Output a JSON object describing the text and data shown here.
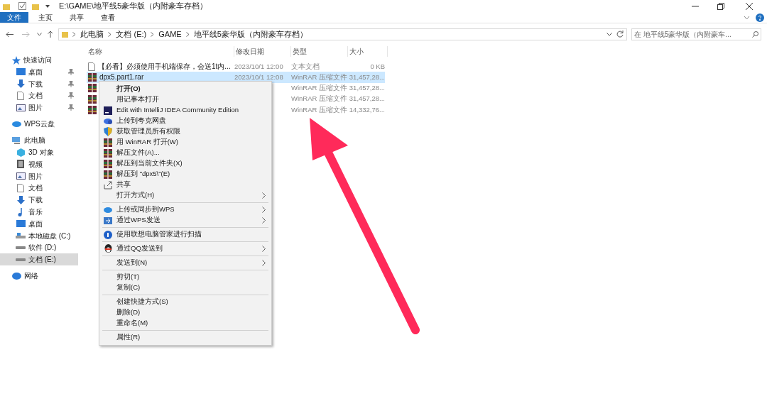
{
  "window": {
    "title": "E:\\GAME\\地平线5豪华版（内附豪车存档）"
  },
  "ribbon_tabs": [
    {
      "label": "文件",
      "selected": true
    },
    {
      "label": "主页",
      "selected": false
    },
    {
      "label": "共享",
      "selected": false
    },
    {
      "label": "查看",
      "selected": false
    }
  ],
  "address_bar": {
    "segments": [
      "此电脑",
      "文档 (E:)",
      "GAME",
      "地平线5豪华版（内附豪车存档）"
    ]
  },
  "search": {
    "placeholder": "在 地平线5豪华版（内附豪车..."
  },
  "sidebar": {
    "items": [
      {
        "label": "快速访问",
        "selected": false,
        "children": [
          {
            "label": "桌面",
            "selected": false,
            "pinned": true
          },
          {
            "label": "下载",
            "selected": false,
            "pinned": true
          },
          {
            "label": "文档",
            "selected": false,
            "pinned": true
          },
          {
            "label": "图片",
            "selected": false,
            "pinned": true
          }
        ]
      },
      {
        "label": "WPS云盘",
        "selected": false
      },
      {
        "label": "此电脑",
        "selected": false,
        "children": [
          {
            "label": "3D 对象",
            "selected": false,
            "pinned": false
          },
          {
            "label": "视频",
            "selected": false,
            "pinned": false
          },
          {
            "label": "图片",
            "selected": false,
            "pinned": false
          },
          {
            "label": "文档",
            "selected": false,
            "pinned": false
          },
          {
            "label": "下载",
            "selected": false,
            "pinned": false
          },
          {
            "label": "音乐",
            "selected": false,
            "pinned": false
          },
          {
            "label": "桌面",
            "selected": false,
            "pinned": false
          },
          {
            "label": "本地磁盘 (C:)",
            "selected": false,
            "pinned": false
          },
          {
            "label": "软件 (D:)",
            "selected": false,
            "pinned": false
          },
          {
            "label": "文档 (E:)",
            "selected": true,
            "pinned": false
          }
        ]
      },
      {
        "label": "网络",
        "selected": false
      }
    ]
  },
  "table": {
    "columns": [
      "名称",
      "修改日期",
      "类型",
      "大小"
    ],
    "rows": [
      {
        "kind": "text",
        "name": "【必看】必须使用手机端保存，会送1t内...",
        "date": "2023/10/1 12:00",
        "type": "文本文档",
        "size": "0 KB",
        "selected": false
      },
      {
        "kind": "rar",
        "name": "dpx5.part1.rar",
        "date": "2023/10/1 12:08",
        "type": "WinRAR 压缩文件",
        "size": "31,457,28...",
        "selected": true
      },
      {
        "kind": "rar",
        "type": "WinRAR 压缩文件",
        "size": "31,457,28...",
        "selected": false
      },
      {
        "kind": "rar",
        "type": "WinRAR 压缩文件",
        "size": "31,457,28...",
        "selected": false
      },
      {
        "kind": "rar",
        "type": "WinRAR 压缩文件",
        "size": "14,332,76...",
        "selected": false
      }
    ]
  },
  "context_menu": {
    "items": [
      {
        "kind": "item",
        "label": "打开(O)",
        "bold": true,
        "submenu": false
      },
      {
        "kind": "item",
        "label": "用记事本打开",
        "bold": false,
        "submenu": false
      },
      {
        "kind": "item",
        "label": "Edit with IntelliJ IDEA Community Edition",
        "bold": false,
        "submenu": false
      },
      {
        "kind": "item",
        "label": "上传到夸克网盘",
        "bold": false,
        "submenu": false
      },
      {
        "kind": "item",
        "label": "获取管理员所有权限",
        "bold": false,
        "submenu": false
      },
      {
        "kind": "item",
        "label": "用 WinRAR 打开(W)",
        "bold": false,
        "submenu": false
      },
      {
        "kind": "item",
        "label": "解压文件(A)...",
        "bold": false,
        "submenu": false
      },
      {
        "kind": "item",
        "label": "解压到当前文件夹(X)",
        "bold": false,
        "submenu": false
      },
      {
        "kind": "item",
        "label": "解压到 \"dpx5\\\"(E)",
        "bold": false,
        "submenu": false
      },
      {
        "kind": "item",
        "label": "共享",
        "bold": false,
        "submenu": false
      },
      {
        "kind": "item",
        "label": "打开方式(H)",
        "bold": false,
        "submenu": true
      },
      {
        "kind": "separator"
      },
      {
        "kind": "item",
        "label": "上传或同步到WPS",
        "bold": false,
        "submenu": true
      },
      {
        "kind": "item",
        "label": "通过WPS发送",
        "bold": false,
        "submenu": true
      },
      {
        "kind": "separator"
      },
      {
        "kind": "item",
        "label": "使用联想电脑管家进行扫描",
        "bold": false,
        "submenu": false
      },
      {
        "kind": "separator"
      },
      {
        "kind": "item",
        "label": "通过QQ发送到",
        "bold": false,
        "submenu": true
      },
      {
        "kind": "separator"
      },
      {
        "kind": "item",
        "label": "发送到(N)",
        "bold": false,
        "submenu": true
      },
      {
        "kind": "separator"
      },
      {
        "kind": "item",
        "label": "剪切(T)",
        "bold": false,
        "submenu": false
      },
      {
        "kind": "item",
        "label": "复制(C)",
        "bold": false,
        "submenu": false
      },
      {
        "kind": "separator"
      },
      {
        "kind": "item",
        "label": "创建快捷方式(S)",
        "bold": false,
        "submenu": false
      },
      {
        "kind": "item",
        "label": "删除(D)",
        "bold": false,
        "submenu": false
      },
      {
        "kind": "item",
        "label": "重命名(M)",
        "bold": false,
        "submenu": false
      },
      {
        "kind": "separator"
      },
      {
        "kind": "item",
        "label": "属性(R)",
        "bold": false,
        "submenu": false
      }
    ]
  }
}
